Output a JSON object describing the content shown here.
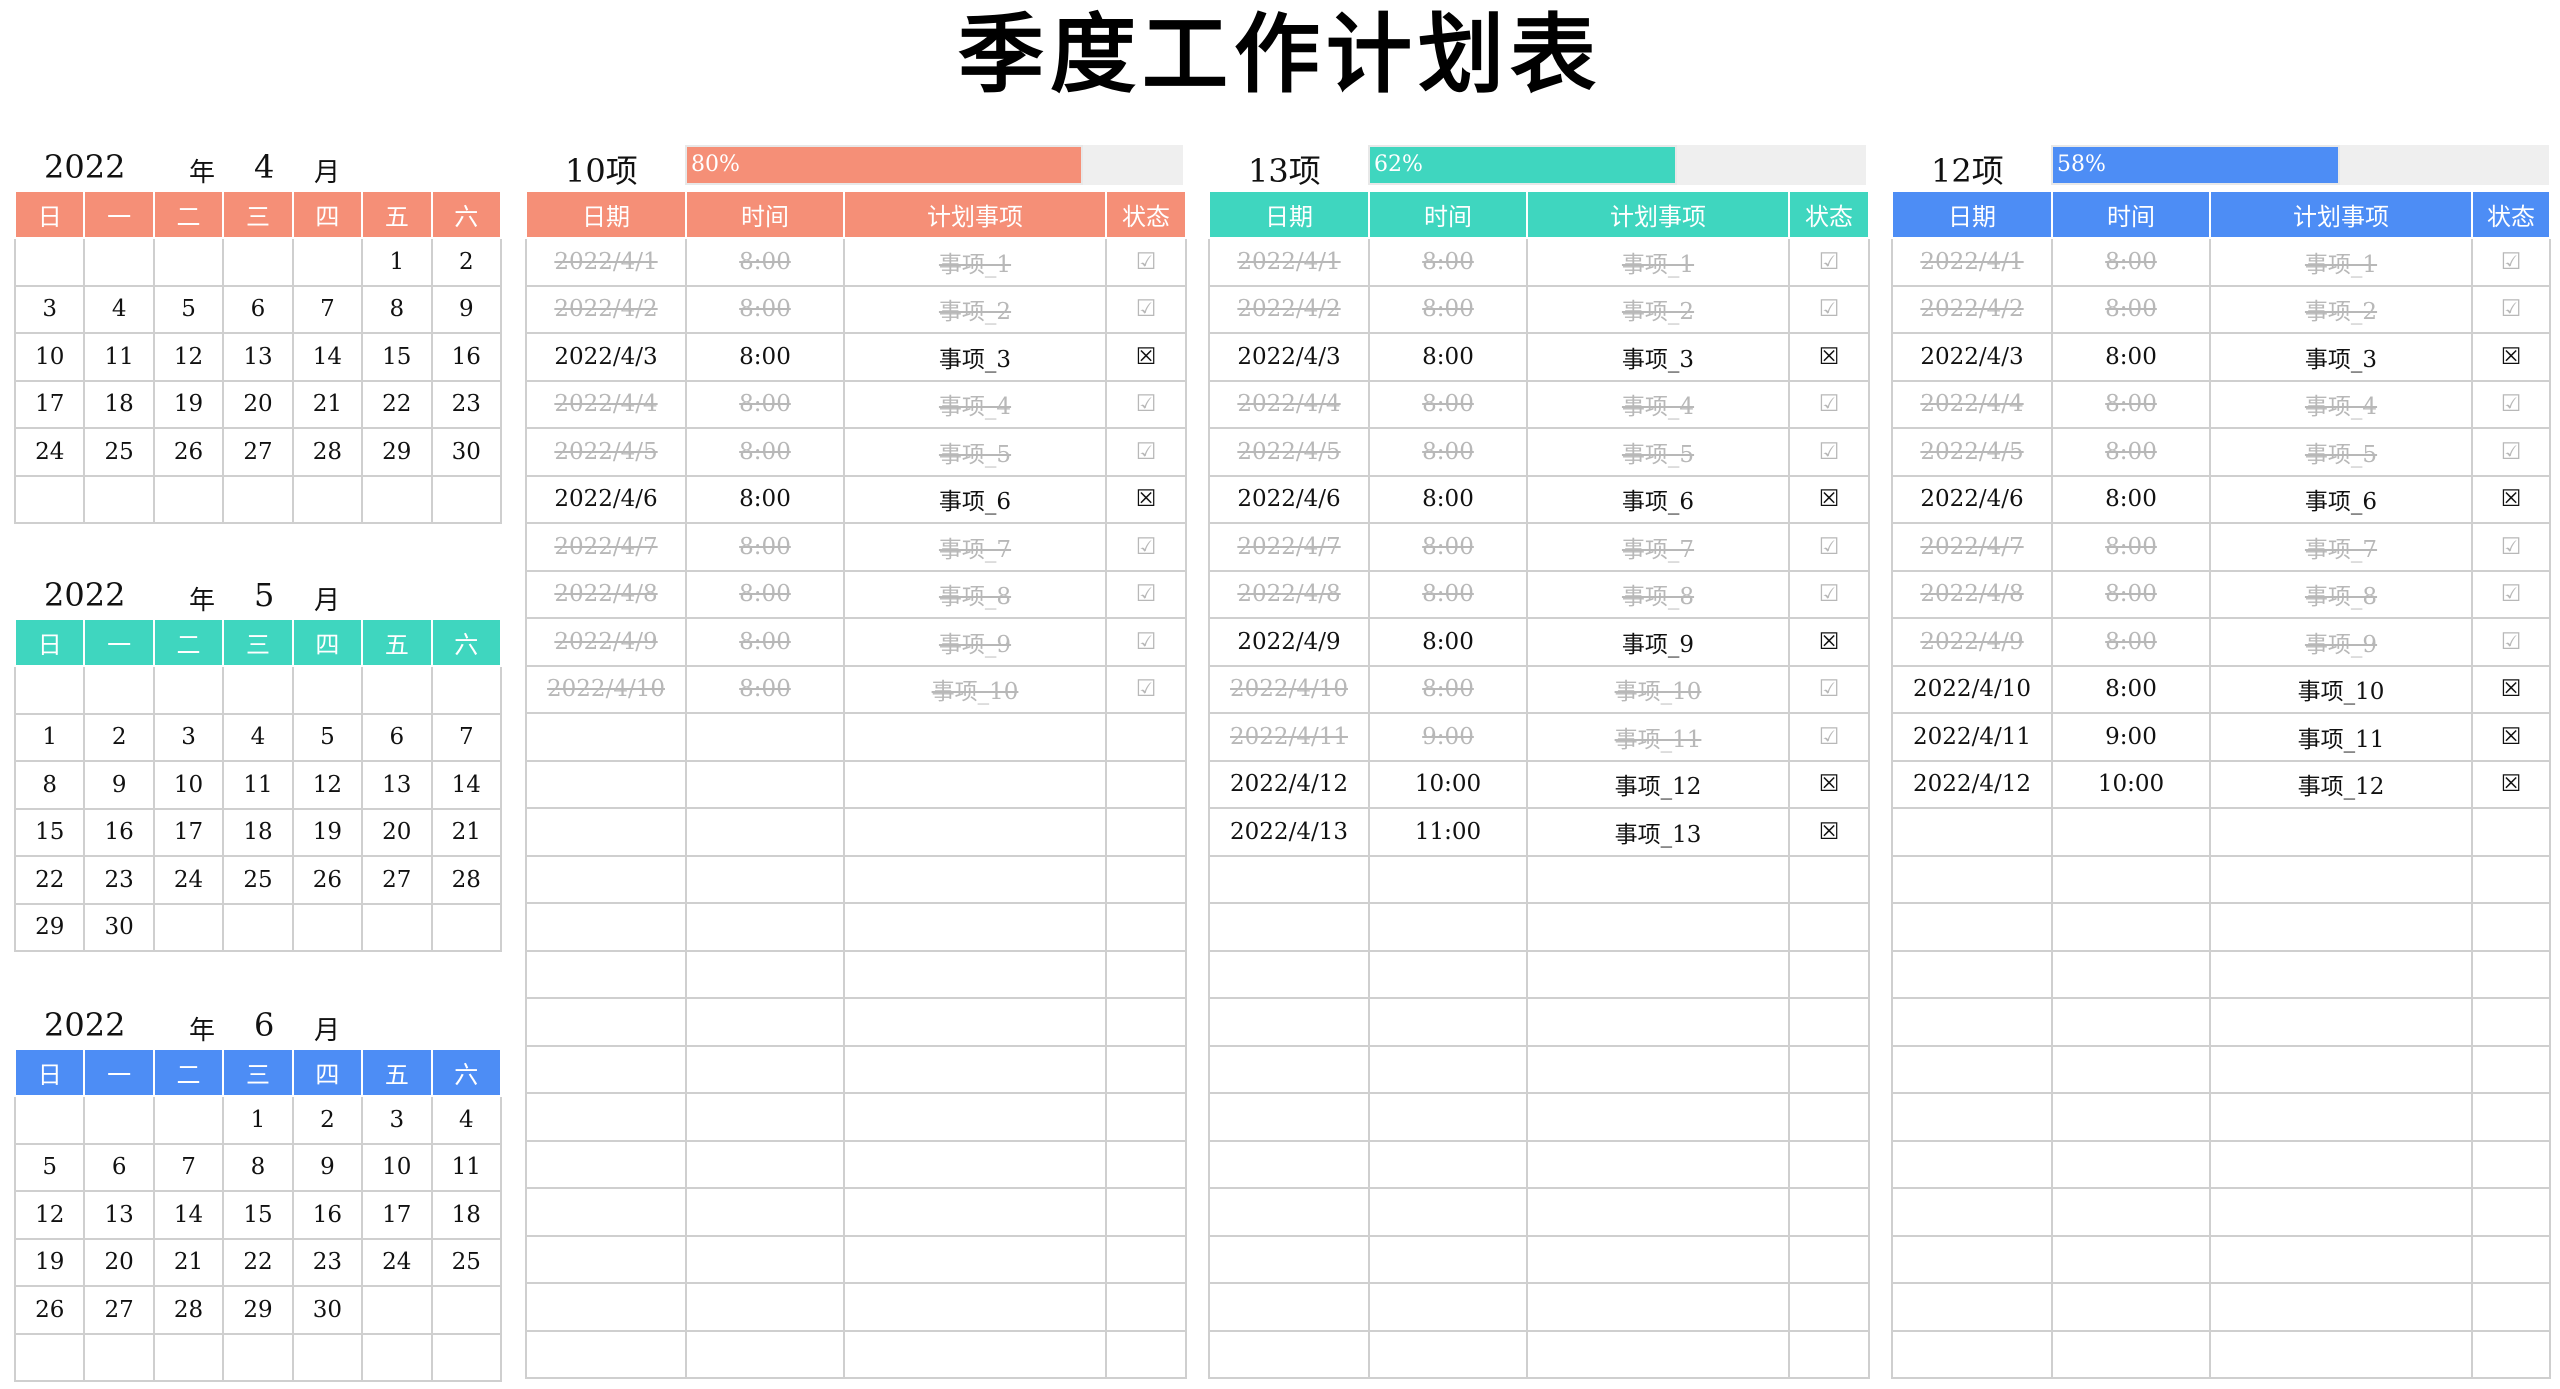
{
  "title": "季度工作计划表",
  "labels": {
    "year": "年",
    "month": "月"
  },
  "colors": {
    "orange": "#f58f77",
    "teal": "#3fd6bf",
    "blue": "#4d8df5"
  },
  "weekdays": [
    "日",
    "一",
    "二",
    "三",
    "四",
    "五",
    "六"
  ],
  "calendars": [
    {
      "year": "2022",
      "month": "4",
      "color": "orange",
      "weeks": [
        [
          "",
          "",
          "",
          "",
          "",
          "1",
          "2"
        ],
        [
          "3",
          "4",
          "5",
          "6",
          "7",
          "8",
          "9"
        ],
        [
          "10",
          "11",
          "12",
          "13",
          "14",
          "15",
          "16"
        ],
        [
          "17",
          "18",
          "19",
          "20",
          "21",
          "22",
          "23"
        ],
        [
          "24",
          "25",
          "26",
          "27",
          "28",
          "29",
          "30"
        ],
        [
          "",
          "",
          "",
          "",
          "",
          "",
          ""
        ]
      ]
    },
    {
      "year": "2022",
      "month": "5",
      "color": "teal",
      "weeks": [
        [
          "",
          "",
          "",
          "",
          "",
          "",
          ""
        ],
        [
          "1",
          "2",
          "3",
          "4",
          "5",
          "6",
          "7"
        ],
        [
          "8",
          "9",
          "10",
          "11",
          "12",
          "13",
          "14"
        ],
        [
          "15",
          "16",
          "17",
          "18",
          "19",
          "20",
          "21"
        ],
        [
          "22",
          "23",
          "24",
          "25",
          "26",
          "27",
          "28"
        ],
        [
          "29",
          "30",
          "",
          "",
          "",
          "",
          ""
        ]
      ]
    },
    {
      "year": "2022",
      "month": "6",
      "color": "blue",
      "weeks": [
        [
          "",
          "",
          "",
          "1",
          "2",
          "3",
          "4"
        ],
        [
          "5",
          "6",
          "7",
          "8",
          "9",
          "10",
          "11"
        ],
        [
          "12",
          "13",
          "14",
          "15",
          "16",
          "17",
          "18"
        ],
        [
          "19",
          "20",
          "21",
          "22",
          "23",
          "24",
          "25"
        ],
        [
          "26",
          "27",
          "28",
          "29",
          "30",
          "",
          ""
        ],
        [
          "",
          "",
          "",
          "",
          "",
          "",
          ""
        ]
      ]
    }
  ],
  "table_headers": [
    "日期",
    "时间",
    "计划事项",
    "状态"
  ],
  "icons": {
    "done": "check-box-icon",
    "pending": "crossed-box-icon"
  },
  "status_glyphs": {
    "done": "☑",
    "pending": "☒"
  },
  "panels": [
    {
      "count_label": "10项",
      "progress_label": "80%",
      "progress": 0.8,
      "color": "orange",
      "tasks": [
        {
          "date": "2022/4/1",
          "time": "8:00",
          "item": "事项_1",
          "done": true
        },
        {
          "date": "2022/4/2",
          "time": "8:00",
          "item": "事项_2",
          "done": true
        },
        {
          "date": "2022/4/3",
          "time": "8:00",
          "item": "事项_3",
          "done": false
        },
        {
          "date": "2022/4/4",
          "time": "8:00",
          "item": "事项_4",
          "done": true
        },
        {
          "date": "2022/4/5",
          "time": "8:00",
          "item": "事项_5",
          "done": true
        },
        {
          "date": "2022/4/6",
          "time": "8:00",
          "item": "事项_6",
          "done": false
        },
        {
          "date": "2022/4/7",
          "time": "8:00",
          "item": "事项_7",
          "done": true
        },
        {
          "date": "2022/4/8",
          "time": "8:00",
          "item": "事项_8",
          "done": true
        },
        {
          "date": "2022/4/9",
          "time": "8:00",
          "item": "事项_9",
          "done": true
        },
        {
          "date": "2022/4/10",
          "time": "8:00",
          "item": "事项_10",
          "done": true
        }
      ]
    },
    {
      "count_label": "13项",
      "progress_label": "62%",
      "progress": 0.62,
      "color": "teal",
      "tasks": [
        {
          "date": "2022/4/1",
          "time": "8:00",
          "item": "事项_1",
          "done": true
        },
        {
          "date": "2022/4/2",
          "time": "8:00",
          "item": "事项_2",
          "done": true
        },
        {
          "date": "2022/4/3",
          "time": "8:00",
          "item": "事项_3",
          "done": false
        },
        {
          "date": "2022/4/4",
          "time": "8:00",
          "item": "事项_4",
          "done": true
        },
        {
          "date": "2022/4/5",
          "time": "8:00",
          "item": "事项_5",
          "done": true
        },
        {
          "date": "2022/4/6",
          "time": "8:00",
          "item": "事项_6",
          "done": false
        },
        {
          "date": "2022/4/7",
          "time": "8:00",
          "item": "事项_7",
          "done": true
        },
        {
          "date": "2022/4/8",
          "time": "8:00",
          "item": "事项_8",
          "done": true
        },
        {
          "date": "2022/4/9",
          "time": "8:00",
          "item": "事项_9",
          "done": false
        },
        {
          "date": "2022/4/10",
          "time": "8:00",
          "item": "事项_10",
          "done": true
        },
        {
          "date": "2022/4/11",
          "time": "9:00",
          "item": "事项_11",
          "done": true
        },
        {
          "date": "2022/4/12",
          "time": "10:00",
          "item": "事项_12",
          "done": false
        },
        {
          "date": "2022/4/13",
          "time": "11:00",
          "item": "事项_13",
          "done": false
        }
      ]
    },
    {
      "count_label": "12项",
      "progress_label": "58%",
      "progress": 0.58,
      "color": "blue",
      "tasks": [
        {
          "date": "2022/4/1",
          "time": "8:00",
          "item": "事项_1",
          "done": true
        },
        {
          "date": "2022/4/2",
          "time": "8:00",
          "item": "事项_2",
          "done": true
        },
        {
          "date": "2022/4/3",
          "time": "8:00",
          "item": "事项_3",
          "done": false
        },
        {
          "date": "2022/4/4",
          "time": "8:00",
          "item": "事项_4",
          "done": true
        },
        {
          "date": "2022/4/5",
          "time": "8:00",
          "item": "事项_5",
          "done": true
        },
        {
          "date": "2022/4/6",
          "time": "8:00",
          "item": "事项_6",
          "done": false
        },
        {
          "date": "2022/4/7",
          "time": "8:00",
          "item": "事项_7",
          "done": true
        },
        {
          "date": "2022/4/8",
          "time": "8:00",
          "item": "事项_8",
          "done": true
        },
        {
          "date": "2022/4/9",
          "time": "8:00",
          "item": "事项_9",
          "done": true
        },
        {
          "date": "2022/4/10",
          "time": "8:00",
          "item": "事项_10",
          "done": false
        },
        {
          "date": "2022/4/11",
          "time": "9:00",
          "item": "事项_11",
          "done": false
        },
        {
          "date": "2022/4/12",
          "time": "10:00",
          "item": "事项_12",
          "done": false
        }
      ]
    }
  ]
}
